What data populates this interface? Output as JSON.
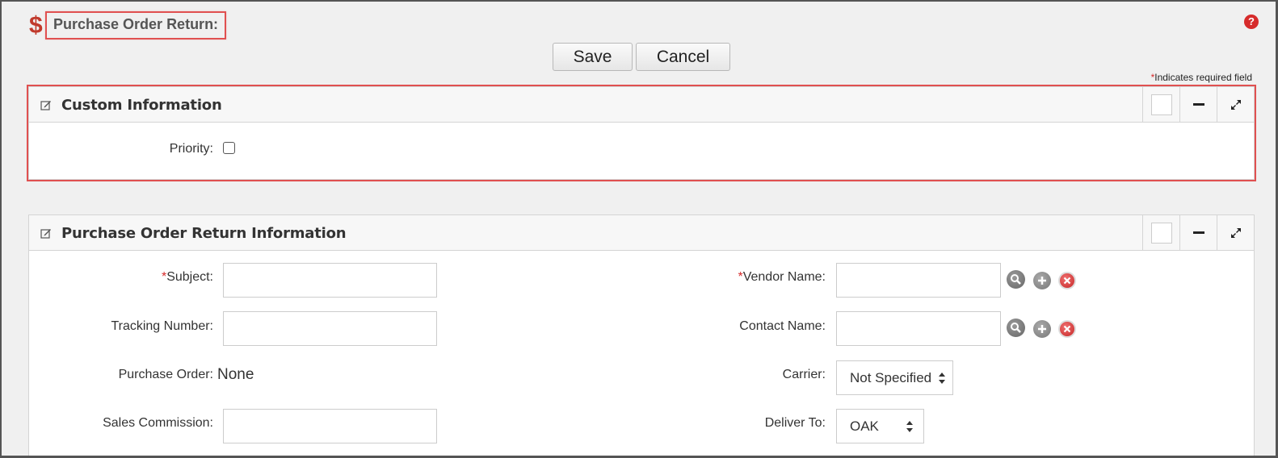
{
  "header": {
    "title": "Purchase Order Return:",
    "help_icon": "help-icon",
    "page_icon": "dollar-icon",
    "accent_color": "#c0392b"
  },
  "actions": {
    "save_label": "Save",
    "cancel_label": "Cancel"
  },
  "required_note": {
    "star": "*",
    "text": "Indicates required field"
  },
  "custom_panel": {
    "title": "Custom Information",
    "fields": {
      "priority_label": "Priority:",
      "priority_checked": false
    }
  },
  "po_return_panel": {
    "title": "Purchase Order Return Information",
    "left": {
      "subject_star": "*",
      "subject_label": "Subject:",
      "subject_value": "",
      "tracking_label": "Tracking Number:",
      "tracking_value": "",
      "purchase_order_label": "Purchase Order:",
      "purchase_order_value": "None",
      "sales_commission_label": "Sales Commission:",
      "sales_commission_value": ""
    },
    "right": {
      "vendor_star": "*",
      "vendor_label": "Vendor Name:",
      "vendor_value": "",
      "contact_label": "Contact Name:",
      "contact_value": "",
      "carrier_label": "Carrier:",
      "carrier_value": "Not Specified",
      "deliver_to_label": "Deliver To:",
      "deliver_to_value": "OAK"
    }
  }
}
